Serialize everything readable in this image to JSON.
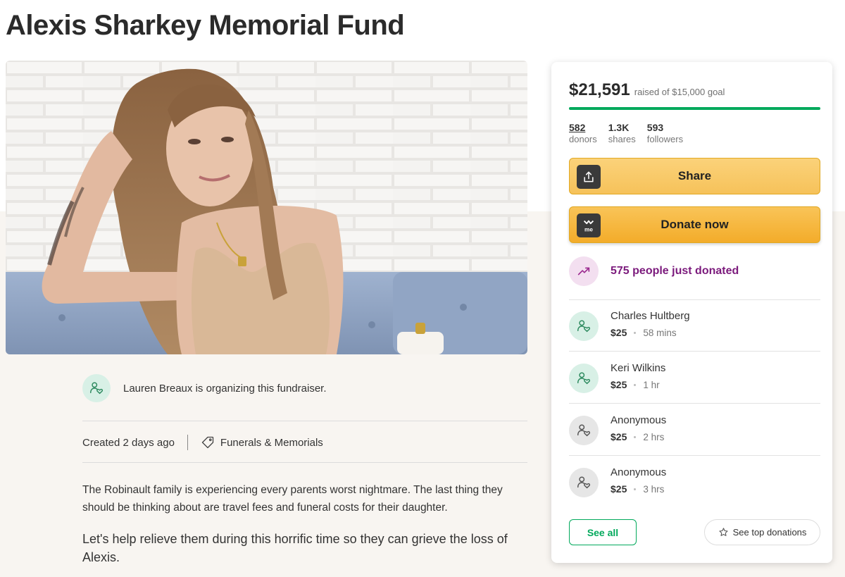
{
  "page": {
    "title": "Alexis Sharkey Memorial Fund"
  },
  "organizer": {
    "text": "Lauren Breaux is organizing this fundraiser."
  },
  "meta": {
    "created": "Created 2 days ago",
    "category": "Funerals & Memorials"
  },
  "description": {
    "paragraph_1": "The Robinault family is experiencing every parents worst nightmare. The last thing they should be thinking about are travel fees and funeral costs for their daughter.",
    "paragraph_2": "Let's help relieve them during this horrific time so they can grieve the loss of Alexis."
  },
  "card": {
    "raised_amount": "$21,591",
    "raised_goal_text": "raised of $15,000 goal",
    "progress_fraction": 1.0,
    "stats": [
      {
        "number": "582",
        "label": "donors"
      },
      {
        "number": "1.3K",
        "label": "shares"
      },
      {
        "number": "593",
        "label": "followers"
      }
    ],
    "share_label": "Share",
    "donate_label": "Donate now",
    "donate_icon_text": "me",
    "just_donated": "575 people just donated",
    "donations": [
      {
        "name": "Charles Hultberg",
        "amount": "$25",
        "time": "58 mins",
        "avatar": "green"
      },
      {
        "name": "Keri Wilkins",
        "amount": "$25",
        "time": "1 hr",
        "avatar": "green"
      },
      {
        "name": "Anonymous",
        "amount": "$25",
        "time": "2 hrs",
        "avatar": "grey"
      },
      {
        "name": "Anonymous",
        "amount": "$25",
        "time": "3 hrs",
        "avatar": "grey"
      }
    ],
    "see_all_label": "See all",
    "see_top_label": "See top donations"
  },
  "colors": {
    "accent_green": "#02a95c",
    "share_button": "#f6c25a",
    "donate_button": "#f3ac2a",
    "just_donated_purple": "#7b1a7c"
  },
  "icons": {
    "share": "share-upload-icon",
    "donate": "gofundme-logo-icon",
    "trend": "trending-up-icon",
    "organizer": "user-heart-icon",
    "tag": "tag-icon",
    "star": "star-icon"
  }
}
